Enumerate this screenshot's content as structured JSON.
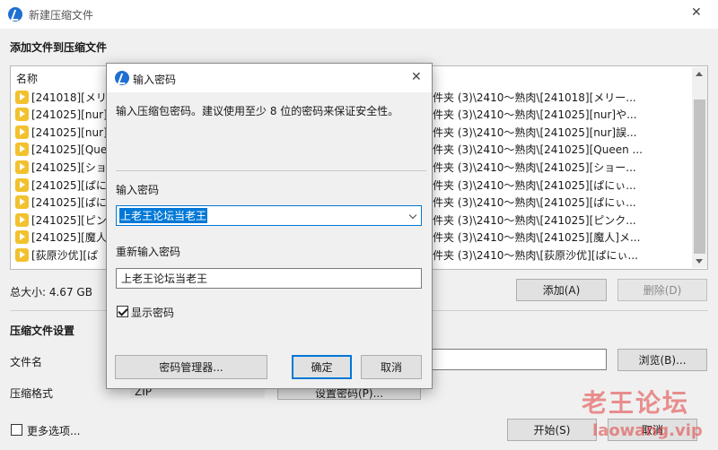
{
  "window": {
    "title": "新建压缩文件",
    "close_glyph": "✕"
  },
  "section_add_title": "添加文件到压缩文件",
  "file_list": {
    "header": "名称",
    "rows": [
      {
        "name": "[241018][メリー",
        "path": "件夹 (3)\\2410～熟肉\\[241018][メリー..."
      },
      {
        "name": "[241025][nur]や",
        "path": "件夹 (3)\\2410～熟肉\\[241025][nur]や..."
      },
      {
        "name": "[241025][nur]誤",
        "path": "件夹 (3)\\2410～熟肉\\[241025][nur]誤..."
      },
      {
        "name": "[241025][Quee",
        "path": "件夹 (3)\\2410～熟肉\\[241025][Queen ..."
      },
      {
        "name": "[241025][ショ",
        "path": "件夹 (3)\\2410～熟肉\\[241025][ショー..."
      },
      {
        "name": "[241025][ぱに",
        "path": "件夹 (3)\\2410～熟肉\\[241025][ぱにぃ..."
      },
      {
        "name": "[241025][ぱに",
        "path": "件夹 (3)\\2410～熟肉\\[241025][ぱにぃ..."
      },
      {
        "name": "[241025][ピン",
        "path": "件夹 (3)\\2410～熟肉\\[241025][ピンク..."
      },
      {
        "name": "[241025][魔人]",
        "path": "件夹 (3)\\2410～熟肉\\[241025][魔人]メ..."
      },
      {
        "name": "[荻原沙优][ぱ",
        "path": "件夹 (3)\\2410～熟肉\\[荻原沙优][ぱにぃ..."
      }
    ]
  },
  "total_size": "总大小: 4.67 GB",
  "add_button": "添加(A)",
  "delete_button": "删除(D)",
  "compression_settings_title": "压缩文件设置",
  "filename_label": "文件名",
  "browse_button": "浏览(B)...",
  "format_label": "压缩格式",
  "format_value": "ZIP",
  "set_password_button": "设置密码(P)...",
  "more_options_label": "更多选项...",
  "start_button": "开始(S)",
  "cancel_main_button": "取消",
  "watermark": {
    "title": "老王论坛",
    "url": "laowang.vip"
  },
  "password_dialog": {
    "title": "输入密码",
    "close_glyph": "✕",
    "description": "输入压缩包密码。建议使用至少 8 位的密码来保证安全性。",
    "enter_label": "输入密码",
    "password_value": "上老王论坛当老王",
    "reenter_label": "重新输入密码",
    "reenter_value": "上老王论坛当老王",
    "show_password_label": "显示密码",
    "show_password_checked": true,
    "manager_button": "密码管理器...",
    "ok_button": "确定",
    "cancel_button": "取消"
  }
}
